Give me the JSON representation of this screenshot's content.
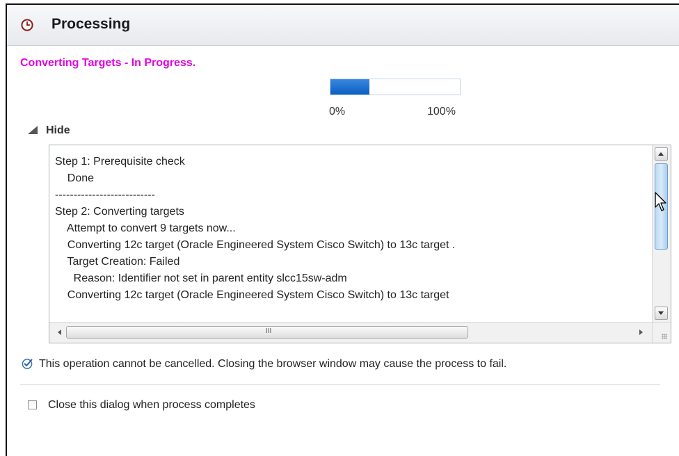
{
  "dialog": {
    "title": "Processing",
    "icon": "clock-icon"
  },
  "status": {
    "text": "Converting Targets - In Progress.",
    "color": "#e000e0"
  },
  "progress": {
    "value_percent": 30,
    "min_label": "0%",
    "max_label": "100%"
  },
  "details_toggle": {
    "label": "Hide",
    "icon": "triangle-collapse-icon"
  },
  "log": {
    "lines": [
      "Step 1: Prerequisite check",
      "    Done",
      "---------------------------",
      "Step 2: Converting targets",
      "    Attempt to convert 9 targets now...",
      "    Converting 12c target (Oracle Engineered System Cisco Switch) to 13c target .",
      "    Target Creation: Failed",
      "      Reason: Identifier not set in parent entity slcc15sw-adm",
      "",
      "    Converting 12c target (Oracle Engineered System Cisco Switch) to 13c target"
    ],
    "scrollbar_grip_glyph": "III"
  },
  "note": {
    "text": "This operation cannot be cancelled. Closing the browser window may cause the process to fail.",
    "icon": "checkmark-info-icon"
  },
  "close_option": {
    "label": "Close this dialog when process completes",
    "checked": false
  }
}
